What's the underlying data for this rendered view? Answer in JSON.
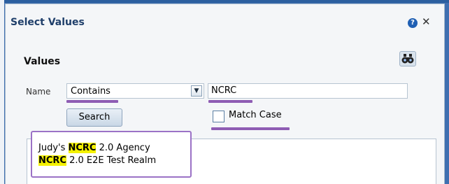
{
  "dialog": {
    "title": "Select Values",
    "help_icon": "question-circle-icon",
    "close_icon": "close-icon"
  },
  "values_section": {
    "title": "Values",
    "binoculars_icon": "binoculars-icon"
  },
  "filter": {
    "name_label": "Name",
    "operator_selected": "Contains",
    "search_text": "NCRC",
    "search_button_label": "Search",
    "match_case_label": "Match Case",
    "match_case_checked": false
  },
  "results": [
    {
      "before": "Judy's ",
      "match": "NCRC",
      "after": " 2.0 Agency"
    },
    {
      "before": "",
      "match": "NCRC",
      "after": " 2.0 E2E Test Realm"
    }
  ],
  "colors": {
    "highlight": "#f4f100",
    "annotation": "#8e5cb3",
    "title": "#1f3f6a"
  }
}
